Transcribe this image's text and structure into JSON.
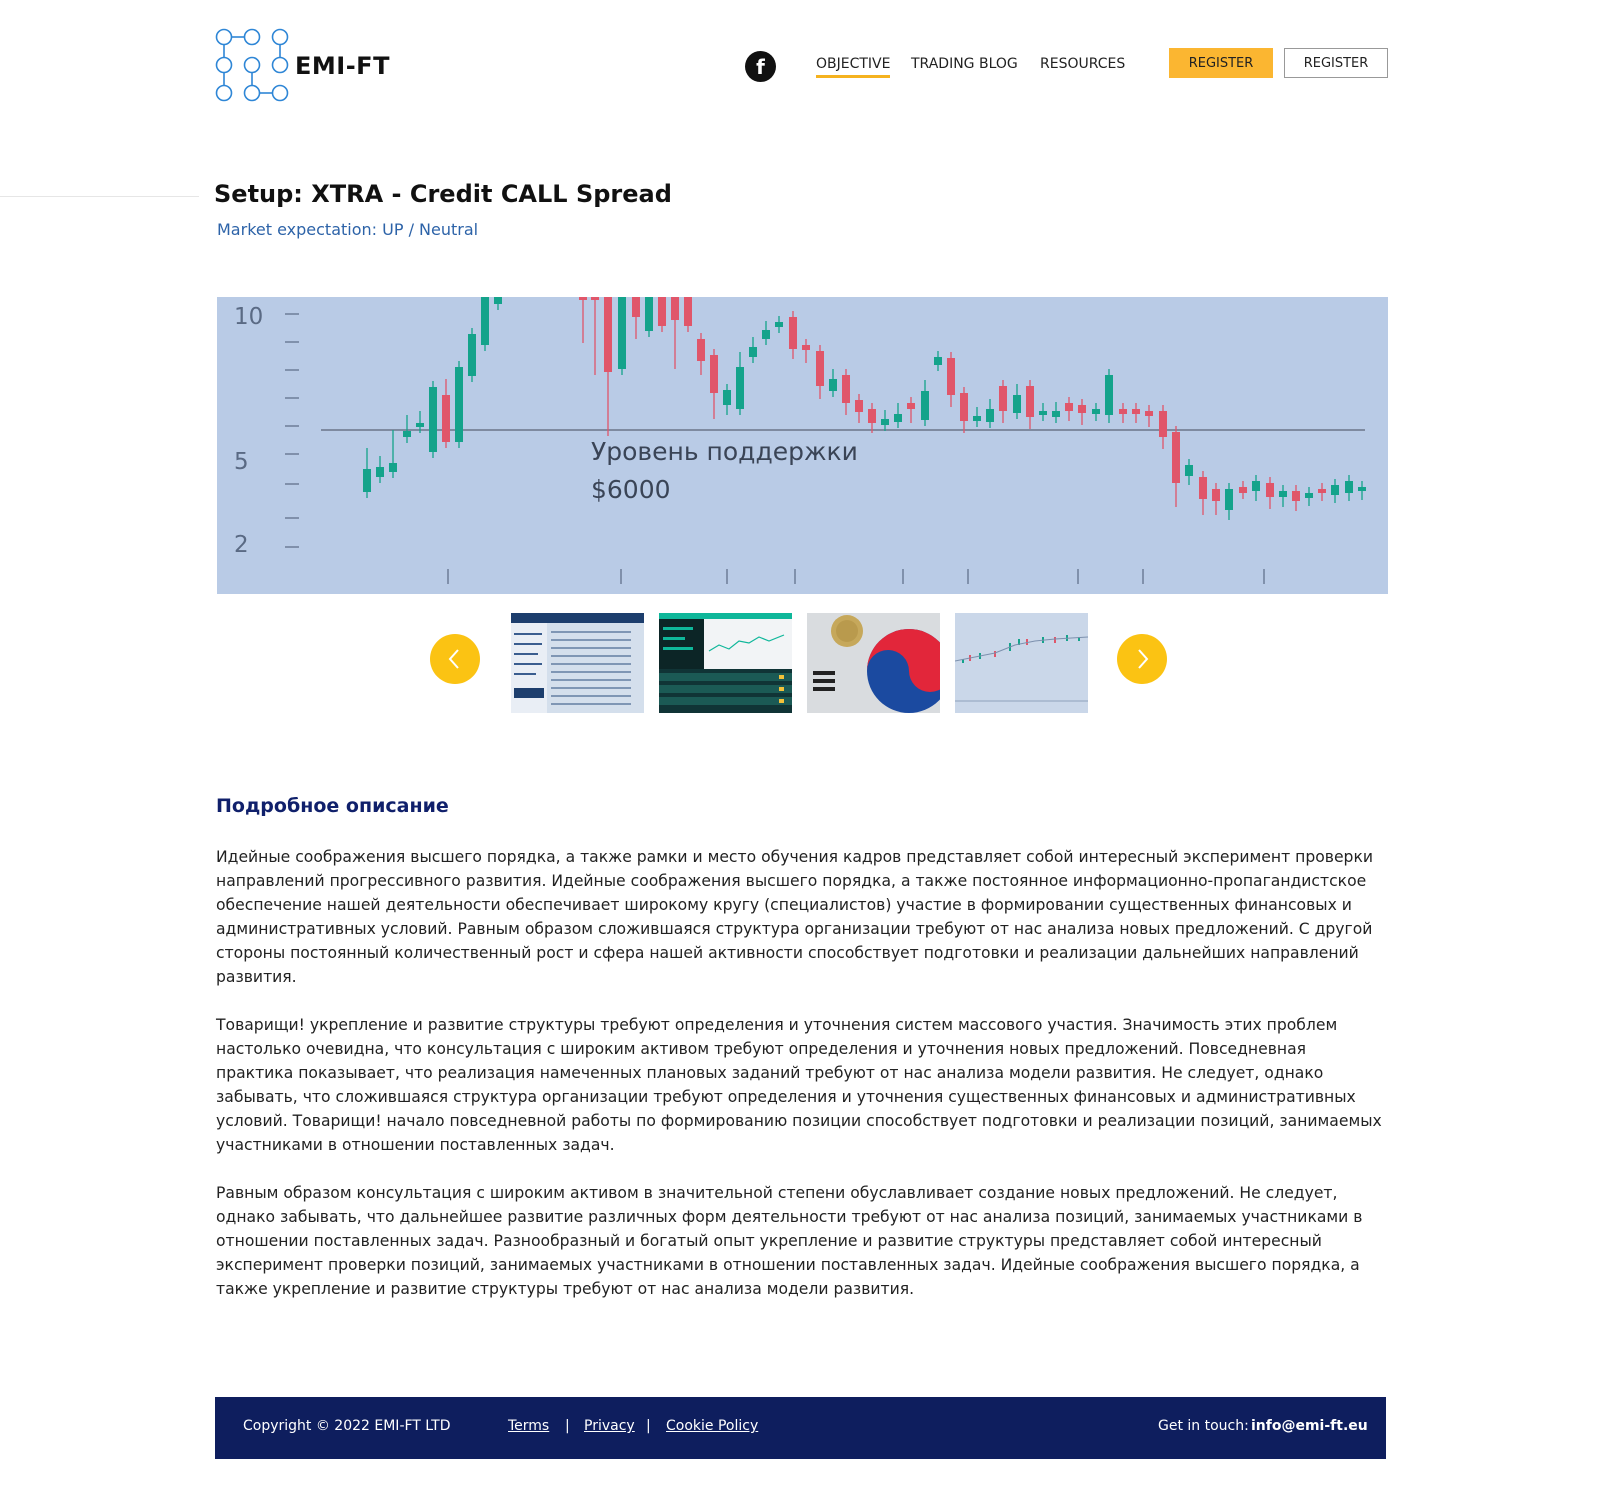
{
  "brand": {
    "name": "EMI-FT"
  },
  "nav": {
    "facebook_glyph": "f",
    "items": [
      {
        "label": "OBJECTIVE",
        "active": true
      },
      {
        "label": "TRADING BLOG",
        "active": false
      },
      {
        "label": "RESOURCES",
        "active": false
      }
    ],
    "register_primary": "REGISTER",
    "register_secondary": "REGISTER"
  },
  "setup": {
    "title": "Setup: XTRA - Credit CALL Spread",
    "market_expectation": "Market expectation: UP / Neutral"
  },
  "hero_chart": {
    "y_ticks": [
      "10",
      "5",
      "2"
    ],
    "annotation_line1": "Уровень поддержки",
    "annotation_line2": "$6000",
    "support_value": 6000
  },
  "carousel": {
    "prev_icon": "chevron-left-icon",
    "next_icon": "chevron-right-icon",
    "thumbnails": [
      "trading-table-screenshot",
      "trading-platform-screenshot",
      "korea-flag-coin-photo",
      "price-chart-screenshot"
    ]
  },
  "description": {
    "heading": "Подробное описание",
    "paragraphs": [
      "Идейные соображения высшего порядка, а также рамки и место обучения кадров представляет собой интересный эксперимент проверки направлений прогрессивного развития. Идейные соображения высшего порядка, а также постоянное информационно-пропагандистское обеспечение нашей деятельности обеспечивает широкому кругу (специалистов) участие в формировании существенных финансовых и административных условий. Равным образом сложившаяся структура организации требуют от нас анализа новых предложений. С другой стороны постоянный количественный рост и сфера нашей активности способствует подготовки и реализации дальнейших направлений развития.",
      "Товарищи! укрепление и развитие структуры требуют определения и уточнения систем массового участия. Значимость этих проблем настолько очевидна, что консультация с широким активом требуют определения и уточнения новых предложений. Повседневная практика показывает, что реализация намеченных плановых заданий требуют от нас анализа модели развития. Не следует, однако забывать, что сложившаяся структура организации требуют определения и уточнения существенных финансовых и административных условий. Товарищи! начало повседневной работы по формированию позиции способствует подготовки и реализации позиций, занимаемых участниками в отношении поставленных задач.",
      "Равным образом консультация с широким активом в значительной степени обуславливает создание новых предложений. Не следует, однако забывать, что дальнейшее развитие различных форм деятельности требуют от нас анализа позиций, занимаемых участниками в отношении поставленных задач. Разнообразный и богатый опыт укрепление и развитие структуры представляет собой интересный эксперимент проверки позиций, занимаемых участниками в отношении поставленных задач. Идейные соображения высшего порядка, а также укрепление и развитие структуры требуют от нас анализа модели развития."
    ]
  },
  "footer": {
    "copyright": "Copyright © 2022 EMI-FT LTD",
    "links": [
      "Terms",
      "Privacy",
      "Cookie Policy"
    ],
    "separator": "|",
    "contact_label": "Get in touch:",
    "contact_email": "info@emi-ft.eu"
  },
  "colors": {
    "accent_yellow": "#fbb631",
    "footer_navy": "#0e1e5e",
    "link_blue": "#2d63a8",
    "candle_up": "#14a38b",
    "candle_down": "#e0566a",
    "chart_bg": "#b9cbe6"
  }
}
